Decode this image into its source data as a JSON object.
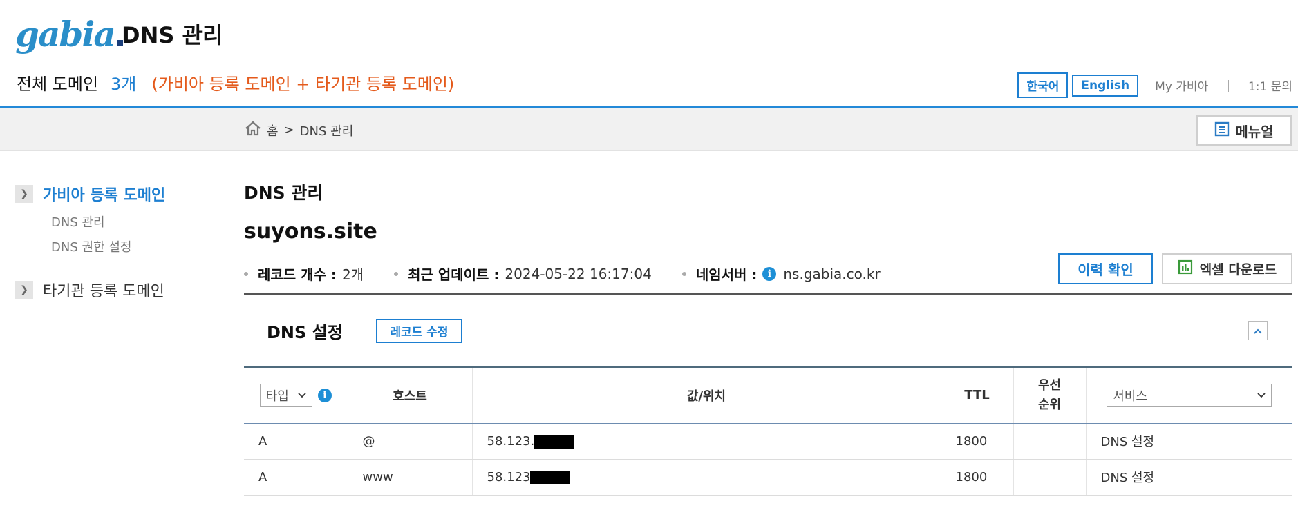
{
  "header": {
    "logo_text": "gabia",
    "app_title": "DNS 관리",
    "domain_summary_label": "전체 도메인",
    "domain_count": "3개",
    "domain_note": "(가비아 등록 도메인 + 타기관 등록 도메인)",
    "lang_korean": "한국어",
    "lang_english": "English",
    "my_gabia": "My 가비아",
    "separator": "|",
    "inquiry": "1:1 문의"
  },
  "breadcrumb": {
    "home": "홈",
    "arrow": ">",
    "current": "DNS 관리"
  },
  "manual_label": "메뉴얼",
  "sidebar": {
    "sections": [
      {
        "label": "가비아 등록 도메인",
        "items": [
          "DNS 관리",
          "DNS 권한 설정"
        ]
      },
      {
        "label": "타기관 등록 도메인"
      }
    ]
  },
  "main": {
    "title": "DNS 관리",
    "domain": "suyons.site",
    "record_count_label": "레코드 개수 :",
    "record_count": "2개",
    "last_update_label": "최근 업데이트 :",
    "last_update": "2024-05-22 16:17:04",
    "nameserver_label": "네임서버 :",
    "nameserver": "ns.gabia.co.kr",
    "history_button": "이력 확인",
    "excel_button": "엑셀 다운로드",
    "dns_settings_title": "DNS 설정",
    "edit_records_button": "레코드 수정"
  },
  "table": {
    "type_filter": "타입",
    "headers": {
      "host": "호스트",
      "value": "값/위치",
      "ttl": "TTL",
      "priority_line1": "우선",
      "priority_line2": "순위"
    },
    "service_filter": "서비스",
    "rows": [
      {
        "type": "A",
        "host": "@",
        "value": "58.123.",
        "ttl": "1800",
        "priority": "",
        "service": "DNS 설정"
      },
      {
        "type": "A",
        "host": "www",
        "value": "58.123",
        "ttl": "1800",
        "priority": "",
        "service": "DNS 설정"
      }
    ]
  },
  "colors": {
    "accent": "#1d7fd1",
    "note_orange": "#e45a1b",
    "header_line": "#2389d8"
  }
}
